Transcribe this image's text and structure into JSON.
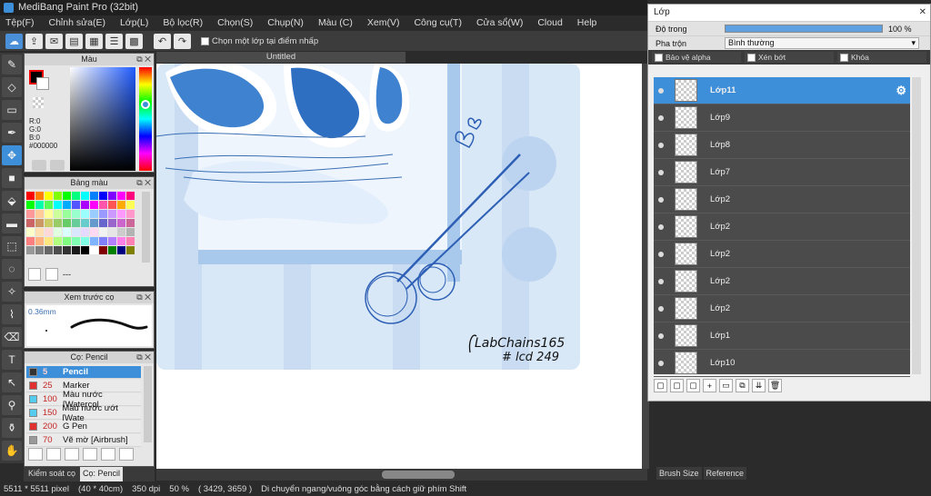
{
  "window": {
    "title": "MediBang Paint Pro (32bit)"
  },
  "menu": [
    "Tệp(F)",
    "Chỉnh sửa(E)",
    "Lớp(L)",
    "Bộ lọc(R)",
    "Chọn(S)",
    "Chụp(N)",
    "Màu (C)",
    "Xem(V)",
    "Công cụ(T)",
    "Cửa sổ(W)",
    "Cloud",
    "Help"
  ],
  "toolbar": {
    "select_layer_label": "Chọn một lớp tại điểm nhấp"
  },
  "color_panel": {
    "title": "Màu",
    "r": "R:0",
    "g": "G:0",
    "b": "B:0",
    "hex": "#000000",
    "hue_level": 0.36
  },
  "palette_panel": {
    "title": "Bảng màu",
    "footer_text": "---",
    "swatches": [
      "#ff0000",
      "#ff7f00",
      "#ffff00",
      "#7fff00",
      "#00ff00",
      "#00ff7f",
      "#00ffff",
      "#007fff",
      "#0000ff",
      "#7f00ff",
      "#ff00ff",
      "#ff007f",
      "#00ff00",
      "#00ffaa",
      "#55ff55",
      "#00ffff",
      "#00aaff",
      "#5555ff",
      "#aa00ff",
      "#ff00ff",
      "#ff55aa",
      "#ff5555",
      "#ffaa00",
      "#ffff55",
      "#ff9999",
      "#ffcc99",
      "#ffff99",
      "#ccff99",
      "#99ff99",
      "#99ffcc",
      "#99ffff",
      "#99ccff",
      "#9999ff",
      "#cc99ff",
      "#ff99ff",
      "#ff99cc",
      "#cc6666",
      "#cc9966",
      "#cccc66",
      "#99cc66",
      "#66cc66",
      "#66cc99",
      "#66cccc",
      "#6699cc",
      "#6666cc",
      "#9966cc",
      "#cc66cc",
      "#cc6699",
      "#ffffcc",
      "#ffe0b3",
      "#ffd9d9",
      "#e0ffe0",
      "#d9ffff",
      "#d9e6ff",
      "#e6d9ff",
      "#ffd9f2",
      "#f2f2f2",
      "#e6e6e6",
      "#cccccc",
      "#b3b3b3",
      "#ff8080",
      "#ffb380",
      "#ffe680",
      "#b3ff80",
      "#80ff80",
      "#80ffb3",
      "#80ffe6",
      "#80b3ff",
      "#8080ff",
      "#b380ff",
      "#ff80e6",
      "#ff80b3",
      "#999999",
      "#7f7f7f",
      "#666666",
      "#4d4d4d",
      "#333333",
      "#1a1a1a",
      "#000000",
      "#ffffff",
      "#800000",
      "#008000",
      "#000080",
      "#808000"
    ]
  },
  "preview_panel": {
    "title": "Xem trước cọ",
    "size": "0.36mm"
  },
  "brush_panel": {
    "title": "Cọ: Pencil",
    "items": [
      {
        "num": "5",
        "name": "Pencil",
        "color": "#333333"
      },
      {
        "num": "25",
        "name": "Marker",
        "color": "#e03030"
      },
      {
        "num": "100",
        "name": "Màu nước [Watercol",
        "color": "#55ccee"
      },
      {
        "num": "150",
        "name": "Màu nước ướt [Wate",
        "color": "#55ccee"
      },
      {
        "num": "200",
        "name": "G Pen",
        "color": "#e03030"
      },
      {
        "num": "70",
        "name": "Vẽ mờ [Airbrush]",
        "color": "#999999"
      }
    ]
  },
  "bottom_tabs": [
    "Kiểm soát cọ",
    "Cọ: Pencil"
  ],
  "canvas": {
    "tab_title": "Untitled",
    "signature_line1": "LabChains165",
    "signature_line2": "# lcd 249"
  },
  "statusbar": {
    "size": "5511 * 5511 pixel",
    "cm": "(40 * 40cm)",
    "dpi": "350 dpi",
    "zoom": "50 %",
    "coords": "( 3429, 3659 )",
    "hint": "Di chuyển ngang/vuông góc bằng cách giữ phím Shift"
  },
  "layer_window": {
    "title": "Lớp",
    "opacity_label": "Độ trong",
    "opacity_value": "100 %",
    "opacity_level": 1.0,
    "blend_label": "Pha trộn",
    "blend_value": "Bình thường",
    "lock_alpha": "Bảo vệ alpha",
    "clipping": "Xén bớt",
    "lock": "Khóa",
    "layers": [
      "Lớp11",
      "Lớp9",
      "Lớp8",
      "Lớp7",
      "Lớp2",
      "Lớp2",
      "Lớp2",
      "Lớp2",
      "Lớp2",
      "Lớp1",
      "Lớp10"
    ]
  },
  "right_tabs": [
    "Brush Size",
    "Reference"
  ]
}
